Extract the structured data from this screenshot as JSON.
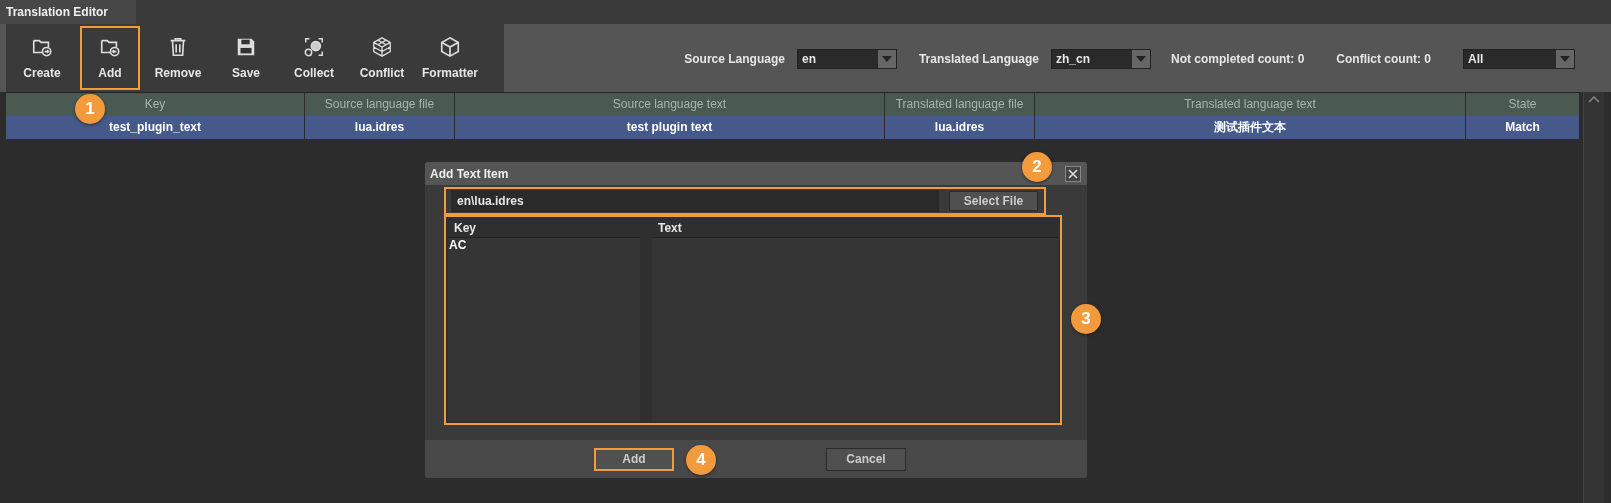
{
  "window": {
    "title": "Translation Editor"
  },
  "toolbar": [
    {
      "label": "Create",
      "kind": "create",
      "highlighted": false
    },
    {
      "label": "Add",
      "kind": "add",
      "highlighted": true,
      "callout": "1"
    },
    {
      "label": "Remove",
      "kind": "remove",
      "highlighted": false
    },
    {
      "label": "Save",
      "kind": "save",
      "highlighted": false
    },
    {
      "label": "Collect",
      "kind": "collect",
      "highlighted": false
    },
    {
      "label": "Conflict",
      "kind": "conflict",
      "highlighted": false
    },
    {
      "label": "Formatter",
      "kind": "formatter",
      "highlighted": false
    }
  ],
  "filters": {
    "source_language": {
      "label": "Source Language",
      "value": "en"
    },
    "translated_language": {
      "label": "Translated Language",
      "value": "zh_cn"
    },
    "not_completed_count": "Not completed count: 0",
    "conflict_count": "Conflict count: 0",
    "state_filter": {
      "value": "All"
    }
  },
  "table": {
    "columns": [
      "Key",
      "Source language file",
      "Source language text",
      "Translated language file",
      "Translated language text",
      "State"
    ],
    "rows": [
      {
        "cells": [
          "test_plugin_text",
          "lua.idres",
          "test plugin text",
          "lua.idres",
          "测试插件文本",
          "Match"
        ],
        "selected": true
      }
    ]
  },
  "dialog": {
    "title": "Add Text Item",
    "file_path": "en\\lua.idres",
    "select_file_button": "Select File",
    "file_row_highlighted": true,
    "file_row_callout": "2",
    "key_header": "Key",
    "text_header": "Text",
    "keys": [
      "AC"
    ],
    "list_highlighted": true,
    "list_callout": "3",
    "buttons": [
      {
        "label": "Add",
        "highlighted": true,
        "callout": "4"
      },
      {
        "label": "Cancel",
        "highlighted": false
      }
    ]
  }
}
